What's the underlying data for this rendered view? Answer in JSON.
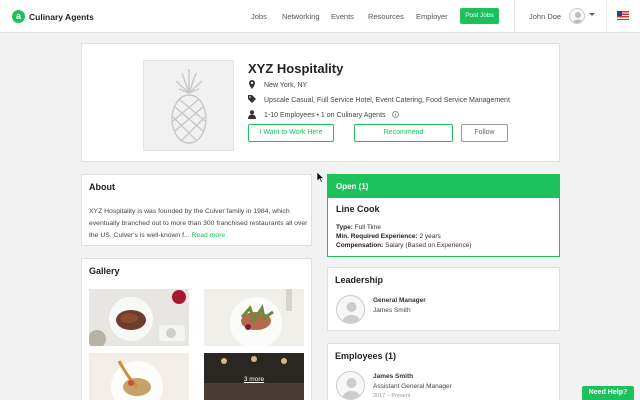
{
  "header": {
    "brand": "Culinary Agents",
    "nav": [
      "Jobs",
      "Networking",
      "Events",
      "Resources",
      "Employer"
    ],
    "post_jobs": "Post Jobs",
    "user_name": "John Doe"
  },
  "profile": {
    "name": "XYZ Hospitality",
    "location": "New York, NY",
    "tags": "Upscale Casual, Full Service Hotel, Event Catering, Food Service Management",
    "employees": "1-10 Employees • 1 on Culinary Agents",
    "btn_work": "I Want to Work Here",
    "btn_recommend": "Recommend",
    "btn_follow": "Follow"
  },
  "about": {
    "title": "About",
    "text": "XYZ Hospitality is was founded by the Culver family in 1984, which eventually branched out to more than 300 franchised restaurants all over the US. Culver's is well-known f...",
    "read_more": "Read more"
  },
  "gallery": {
    "title": "Gallery",
    "more": "3 more"
  },
  "open": {
    "header": "Open (1)",
    "job_title": "Line Cook",
    "type_label": "Type:",
    "type_value": "Full Time",
    "exp_label": "Min. Required Experience:",
    "exp_value": "2 years",
    "comp_label": "Compensation:",
    "comp_value": "Salary (Based on Experience)"
  },
  "leadership": {
    "title": "Leadership",
    "role": "General Manager",
    "name": "James Smith"
  },
  "employees": {
    "title": "Employees (1)",
    "name": "James Smith",
    "role": "Assistant General Manager",
    "dates": "2017 – Present"
  },
  "help": "Need Help?",
  "colors": {
    "brand_green": "#1cc15c"
  }
}
